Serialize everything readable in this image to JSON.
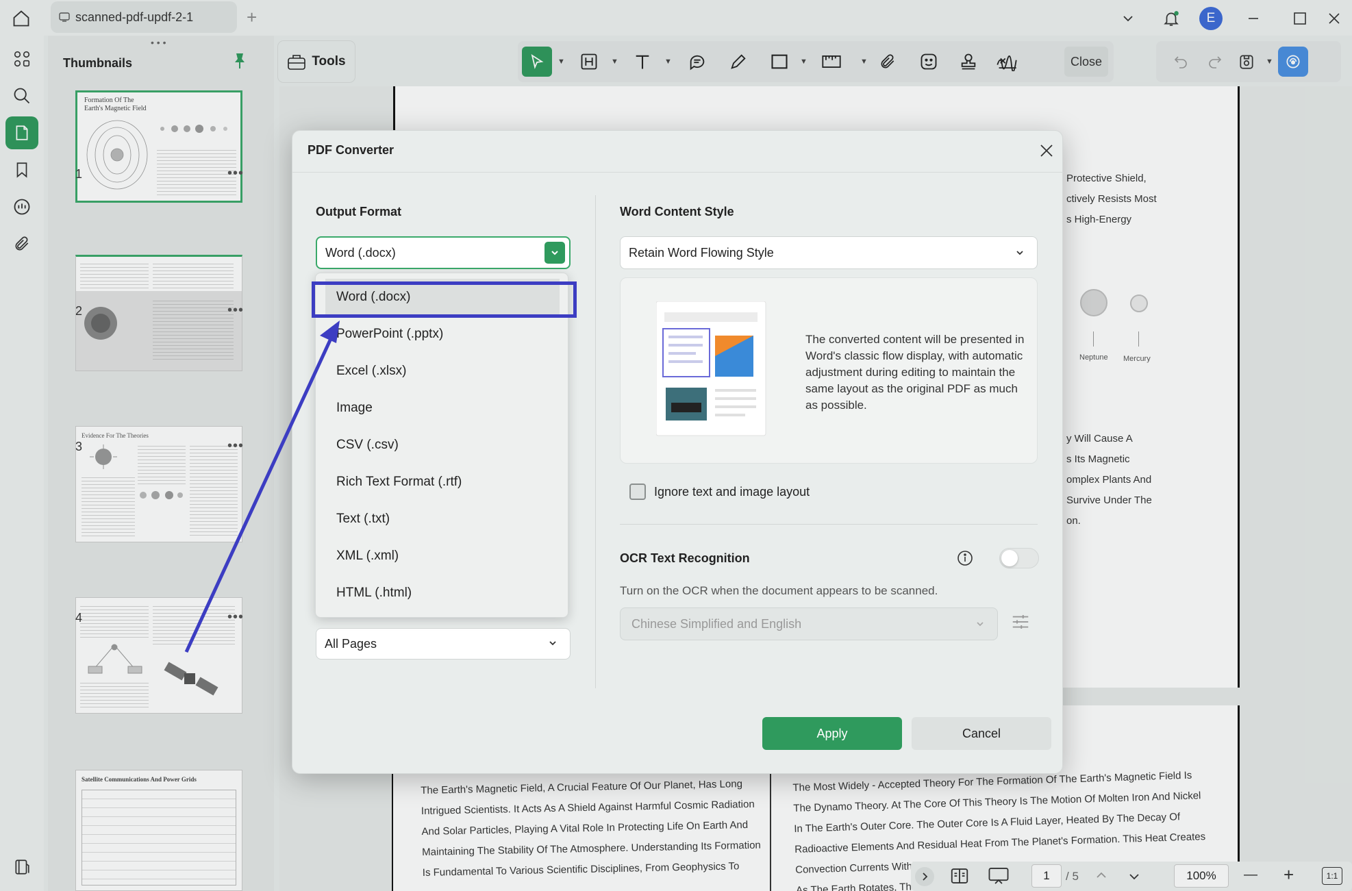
{
  "titlebar": {
    "tab_title": "scanned-pdf-updf-2-1",
    "new_tab": "+",
    "avatar_letter": "E"
  },
  "thumbnails": {
    "title": "Thumbnails",
    "pages": [
      {
        "number": "1",
        "heading": "Formation Of The Earth's Magnetic Field",
        "selected": true
      },
      {
        "number": "2",
        "selected": false
      },
      {
        "number": "3",
        "heading": "Evidence For The Theories",
        "selected": false
      },
      {
        "number": "4",
        "selected": false
      },
      {
        "number": "",
        "heading": "Satellite Communications And Power Grids",
        "selected": false
      }
    ],
    "more": "•••"
  },
  "toolbar": {
    "tools_label": "Tools",
    "close_label": "Close"
  },
  "document": {
    "page1_right_lines": [
      "Protective Shield,",
      "ctively Resists Most",
      "s High-Energy"
    ],
    "page1_right_lines2": [
      "y Will Cause A",
      "s Its Magnetic",
      "omplex Plants And",
      "Survive Under The",
      "on."
    ],
    "planet_labels": [
      "Neptune",
      "Mercury"
    ],
    "page2_left_lines": [
      "The Earth's Magnetic Field, A Crucial Feature Of Our Planet, Has Long",
      "Intrigued Scientists. It Acts As A Shield Against Harmful Cosmic Radiation",
      "And Solar Particles, Playing A Vital Role In Protecting Life On Earth And",
      "Maintaining The Stability Of The Atmosphere. Understanding Its Formation",
      "Is Fundamental To Various Scientific Disciplines, From Geophysics To"
    ],
    "page2_right_lines": [
      "The Most Widely - Accepted Theory For The Formation Of The Earth's Magnetic Field Is",
      "The Dynamo Theory. At The Core Of This Theory Is The Motion Of Molten Iron And Nickel",
      "In The Earth's Outer Core. The Outer Core Is A Fluid Layer, Heated By The Decay Of",
      "Radioactive Elements And Residual Heat From The Planet's Formation. This Heat Creates",
      "Convection Currents Withi",
      "As The Earth Rotates, The"
    ]
  },
  "statusbar": {
    "current_page": "1",
    "total_pages": "/ 5",
    "zoom": "100%",
    "zoom_out": "—",
    "zoom_in": "+",
    "fit": "1:1"
  },
  "modal": {
    "title": "PDF Converter",
    "output_format_title": "Output Format",
    "output_format_value": "Word (.docx)",
    "page_range_value": "All Pages",
    "format_options": [
      "Word (.docx)",
      "PowerPoint (.pptx)",
      "Excel (.xlsx)",
      "Image",
      "CSV (.csv)",
      "Rich Text Format (.rtf)",
      "Text (.txt)",
      "XML (.xml)",
      "HTML (.html)"
    ],
    "word_style_title": "Word Content Style",
    "word_style_value": "Retain Word Flowing Style",
    "style_description": "The converted content will be presented in Word's classic flow display, with automatic adjustment during editing to maintain the same layout as the original PDF as much as possible.",
    "ignore_layout_label": "Ignore text and image layout",
    "ocr_title": "OCR Text Recognition",
    "ocr_hint": "Turn on the OCR when the document appears to be scanned.",
    "ocr_language": "Chinese Simplified and English",
    "apply_label": "Apply",
    "cancel_label": "Cancel"
  },
  "colors": {
    "accent_green": "#2f9a5d",
    "highlight_blue": "#3c3dc2"
  }
}
